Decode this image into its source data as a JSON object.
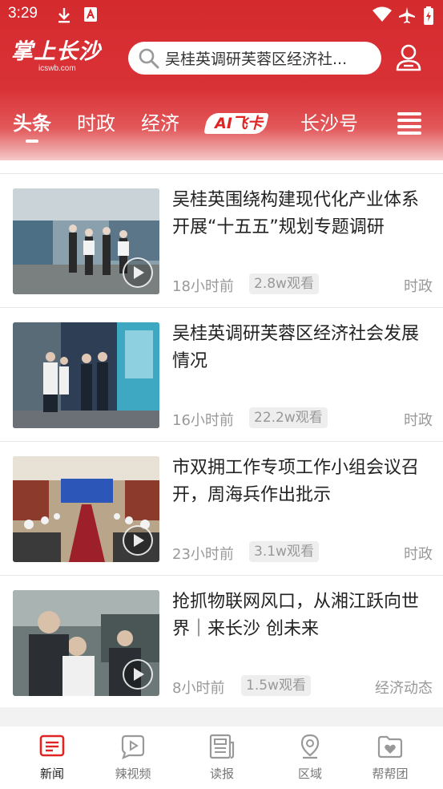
{
  "status_bar": {
    "time": "3:29"
  },
  "header": {
    "logo_text": "掌上长沙",
    "logo_domain": "icswb.com",
    "search_placeholder": "吴桂英调研芙蓉区经济社...",
    "tabs": [
      {
        "label": "头条",
        "active": true
      },
      {
        "label": "时政",
        "active": false
      },
      {
        "label": "经济",
        "active": false
      },
      {
        "label": "AI飞卡",
        "active": false
      },
      {
        "label": "长沙号",
        "active": false
      }
    ]
  },
  "news": [
    {
      "title": "吴桂英围绕构建现代化产业体系开展“十五五”规划专题调研",
      "time": "18小时前",
      "views": "2.8w观看",
      "category": "时政",
      "has_video": true
    },
    {
      "title": "吴桂英调研芙蓉区经济社会发展情况",
      "time": "16小时前",
      "views": "22.2w观看",
      "category": "时政",
      "has_video": false
    },
    {
      "title": "市双拥工作专项工作小组会议召开，周海兵作出批示",
      "time": "23小时前",
      "views": "3.1w观看",
      "category": "时政",
      "has_video": true
    },
    {
      "title": "抢抓物联网风口，从湘江跃向世界｜来长沙 创未来",
      "time": "8小时前",
      "views": "1.5w观看",
      "category": "经济动态",
      "has_video": true
    }
  ],
  "bottom_nav": [
    {
      "label": "新闻",
      "icon": "news-icon",
      "active": true
    },
    {
      "label": "辣视频",
      "icon": "video-icon",
      "active": false
    },
    {
      "label": "读报",
      "icon": "newspaper-icon",
      "active": false
    },
    {
      "label": "区域",
      "icon": "location-icon",
      "active": false
    },
    {
      "label": "帮帮团",
      "icon": "folder-heart-icon",
      "active": false
    }
  ],
  "colors": {
    "brand_red": "#d42a2e",
    "nav_active": "#e02424"
  }
}
